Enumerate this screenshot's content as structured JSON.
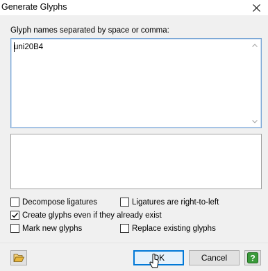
{
  "window": {
    "title": "Generate Glyphs"
  },
  "input": {
    "label": "Glyph names separated by space or comma:",
    "value": "uni20B4"
  },
  "options": {
    "decompose_ligatures": {
      "label": "Decompose ligatures",
      "checked": false
    },
    "ligatures_rtl": {
      "label": "Ligatures are right-to-left",
      "checked": false
    },
    "create_even_if_exist": {
      "label": "Create glyphs even if they already exist",
      "checked": true
    },
    "mark_new_glyphs": {
      "label": "Mark new glyphs",
      "checked": false
    },
    "replace_existing": {
      "label": "Replace existing glyphs",
      "checked": false
    }
  },
  "buttons": {
    "ok": "OK",
    "cancel": "Cancel"
  },
  "colors": {
    "accent": "#0078d7",
    "help_icon": "#3a9a3a",
    "folder_icon": "#e8b63c"
  },
  "icons": {
    "close": "close-icon",
    "folder": "folder-open-icon",
    "help": "help-icon"
  }
}
